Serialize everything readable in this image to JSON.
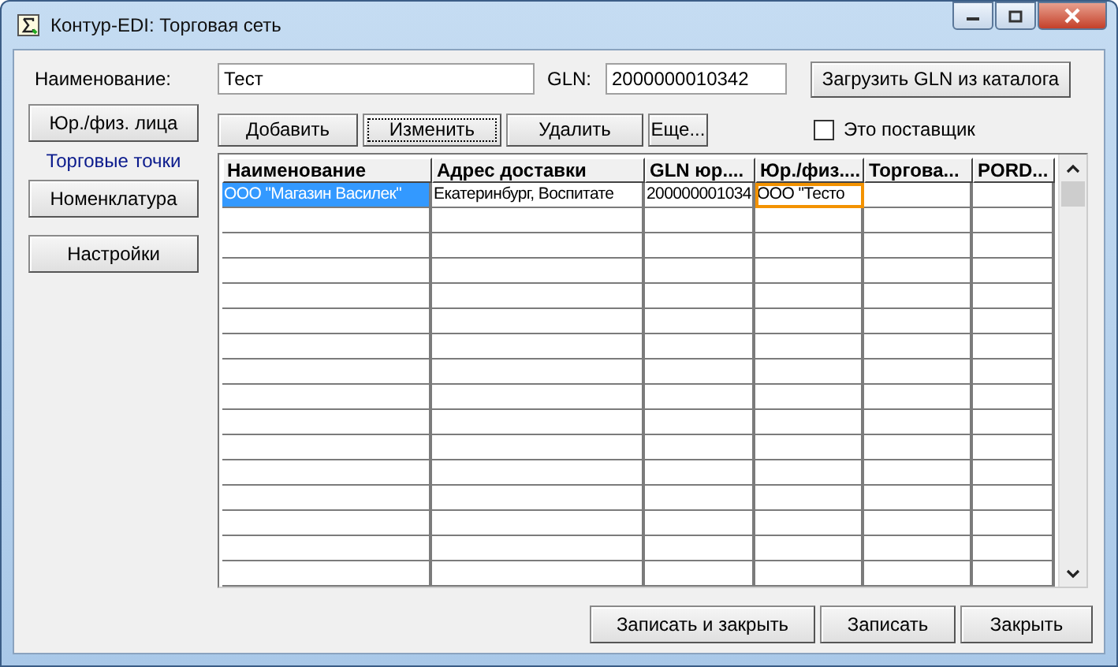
{
  "window": {
    "title": "Контур-EDI: Торговая сеть"
  },
  "name_field": {
    "label": "Наименование:",
    "value": "Тест"
  },
  "gln_field": {
    "label": "GLN:",
    "value": "2000000010342"
  },
  "load_gln_button": "Загрузить GLN из каталога",
  "sidebar": {
    "items": [
      {
        "label": "Юр./физ. лица",
        "selected": false
      },
      {
        "label": "Торговые точки",
        "selected": true
      },
      {
        "label": "Номенклатура",
        "selected": false
      }
    ],
    "settings_button": "Настройки"
  },
  "toolbar": {
    "buttons": [
      {
        "label": "Добавить",
        "focused": false
      },
      {
        "label": "Изменить",
        "focused": true
      },
      {
        "label": "Удалить",
        "focused": false
      },
      {
        "label": "Еще...",
        "focused": false
      }
    ],
    "supplier_checkbox": {
      "label": "Это поставщик",
      "checked": false
    }
  },
  "table": {
    "columns": [
      "Наименование",
      "Адрес доставки",
      "GLN юр....",
      "Юр./физ....",
      "Торгова...",
      "PORD..."
    ],
    "rows": [
      {
        "cells": [
          {
            "text": "ООО \"Магазин Василек\"",
            "selected": true,
            "focused": false
          },
          {
            "text": "Екатеринбург, Воспитате",
            "selected": false,
            "focused": false
          },
          {
            "text": "200000001034",
            "selected": false,
            "focused": false
          },
          {
            "text": "ООО \"Тесто",
            "selected": false,
            "focused": true
          },
          {
            "text": "",
            "selected": false,
            "focused": false
          },
          {
            "text": "",
            "selected": false,
            "focused": false
          }
        ]
      }
    ]
  },
  "footer_buttons": [
    "Записать и закрыть",
    "Записать",
    "Закрыть"
  ]
}
